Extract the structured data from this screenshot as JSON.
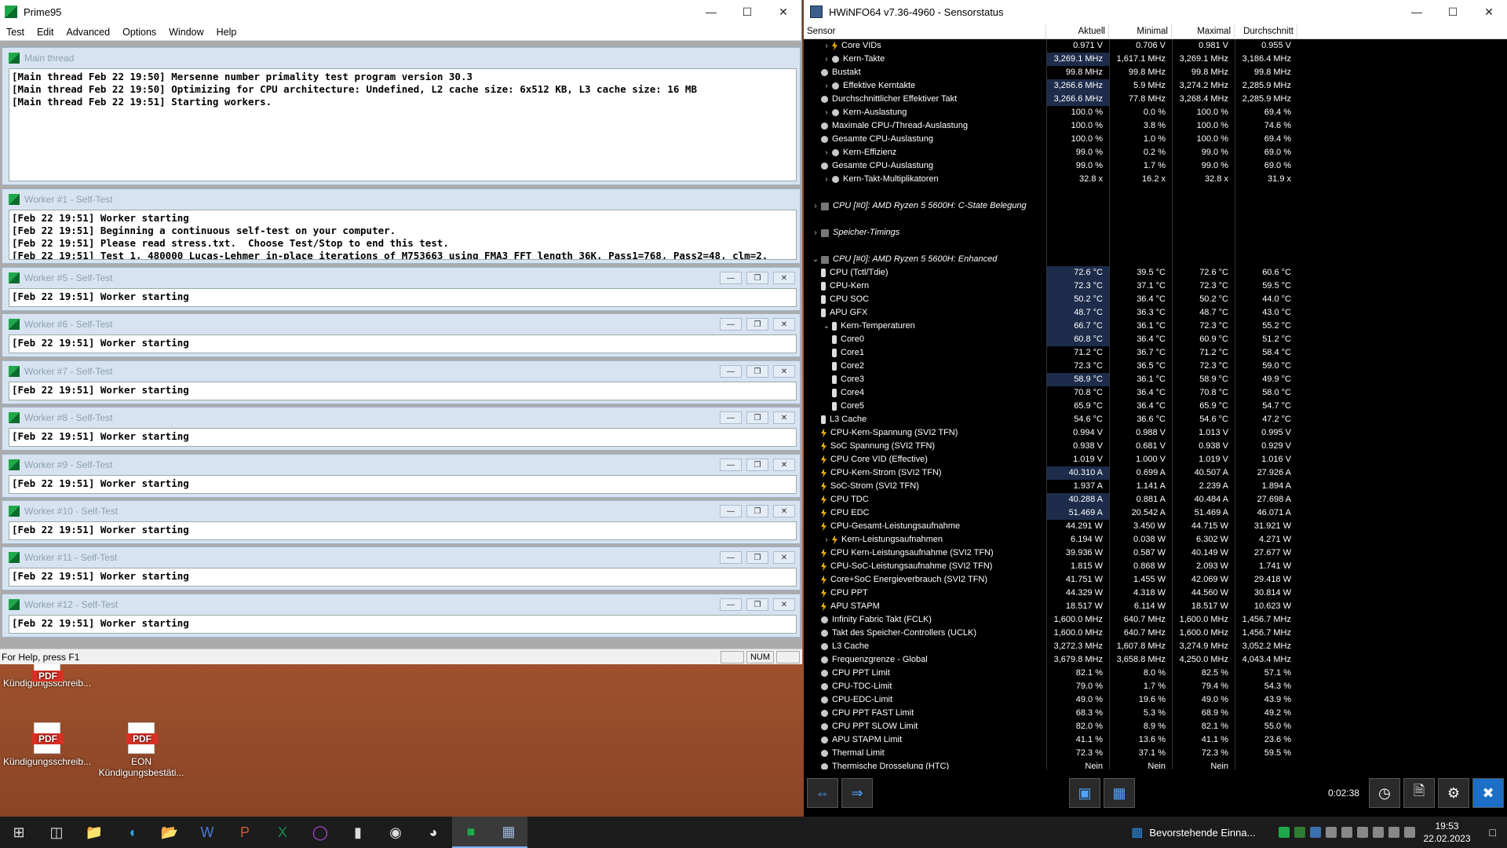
{
  "prime95": {
    "title": "Prime95",
    "menu": [
      "Test",
      "Edit",
      "Advanced",
      "Options",
      "Window",
      "Help"
    ],
    "main": {
      "title": "Main thread",
      "lines": [
        "[Main thread Feb 22 19:50] Mersenne number primality test program version 30.3",
        "[Main thread Feb 22 19:50] Optimizing for CPU architecture: Undefined, L2 cache size: 6x512 KB, L3 cache size: 16 MB",
        "[Main thread Feb 22 19:51] Starting workers."
      ]
    },
    "worker1": {
      "title": "Worker #1 - Self-Test",
      "lines": [
        "[Feb 22 19:51] Worker starting",
        "[Feb 22 19:51] Beginning a continuous self-test on your computer.",
        "[Feb 22 19:51] Please read stress.txt.  Choose Test/Stop to end this test.",
        "[Feb 22 19:51] Test 1, 480000 Lucas-Lehmer in-place iterations of M753663 using FMA3 FFT length 36K, Pass1=768, Pass2=48, clm=2."
      ]
    },
    "workers": [
      {
        "title": "Worker #5 - Self-Test",
        "line": "[Feb 22 19:51] Worker starting"
      },
      {
        "title": "Worker #6 - Self-Test",
        "line": "[Feb 22 19:51] Worker starting"
      },
      {
        "title": "Worker #7 - Self-Test",
        "line": "[Feb 22 19:51] Worker starting"
      },
      {
        "title": "Worker #8 - Self-Test",
        "line": "[Feb 22 19:51] Worker starting"
      },
      {
        "title": "Worker #9 - Self-Test",
        "line": "[Feb 22 19:51] Worker starting"
      },
      {
        "title": "Worker #10 - Self-Test",
        "line": "[Feb 22 19:51] Worker starting"
      },
      {
        "title": "Worker #11 - Self-Test",
        "line": "[Feb 22 19:51] Worker starting"
      },
      {
        "title": "Worker #12 - Self-Test",
        "line": "[Feb 22 19:51] Worker starting"
      }
    ],
    "status": {
      "help": "For Help, press F1",
      "num": "NUM"
    }
  },
  "desktop": {
    "icons": [
      {
        "label": "Kündigungsschreib...",
        "icon": "pdf-icon"
      },
      {
        "label": "Kündigungsschreib...",
        "icon": "pdf-icon"
      },
      {
        "label": "EON Kündigungsbestäti...",
        "icon": "pdf-icon"
      }
    ]
  },
  "hwinfo": {
    "title": "HWiNFO64 v7.36-4960 - Sensorstatus",
    "columns": [
      "Sensor",
      "Aktuell",
      "Minimal",
      "Maximal",
      "Durchschnitt"
    ],
    "rows": [
      {
        "n": "Core VIDs",
        "i": "y",
        "e": ">",
        "l": 1,
        "v": [
          "0.971 V",
          "0.706 V",
          "0.981 V",
          "0.955 V"
        ]
      },
      {
        "n": "Kern-Takte",
        "i": "g",
        "e": ">",
        "l": 1,
        "h": 1,
        "v": [
          "3,269.1 MHz",
          "1,617.1 MHz",
          "3,269.1 MHz",
          "3,186.4 MHz"
        ]
      },
      {
        "n": "Bustakt",
        "i": "g",
        "e": "",
        "l": 0,
        "v": [
          "99.8 MHz",
          "99.8 MHz",
          "99.8 MHz",
          "99.8 MHz"
        ]
      },
      {
        "n": "Effektive Kerntakte",
        "i": "g",
        "e": ">",
        "l": 1,
        "h": 1,
        "v": [
          "3,266.6 MHz",
          "5.9 MHz",
          "3,274.2 MHz",
          "2,285.9 MHz"
        ]
      },
      {
        "n": "Durchschnittlicher Effektiver Takt",
        "i": "g",
        "e": "",
        "l": 0,
        "h": 1,
        "v": [
          "3,266.6 MHz",
          "77.8 MHz",
          "3,268.4 MHz",
          "2,285.9 MHz"
        ]
      },
      {
        "n": "Kern-Auslastung",
        "i": "g",
        "e": ">",
        "l": 1,
        "v": [
          "100.0 %",
          "0.0 %",
          "100.0 %",
          "69.4 %"
        ]
      },
      {
        "n": "Maximale CPU-/Thread-Auslastung",
        "i": "g",
        "e": "",
        "l": 0,
        "v": [
          "100.0 %",
          "3.8 %",
          "100.0 %",
          "74.6 %"
        ]
      },
      {
        "n": "Gesamte CPU-Auslastung",
        "i": "g",
        "e": "",
        "l": 0,
        "v": [
          "100.0 %",
          "1.0 %",
          "100.0 %",
          "69.4 %"
        ]
      },
      {
        "n": "Kern-Effizienz",
        "i": "g",
        "e": ">",
        "l": 1,
        "v": [
          "99.0 %",
          "0.2 %",
          "99.0 %",
          "69.0 %"
        ]
      },
      {
        "n": "Gesamte CPU-Auslastung",
        "i": "g",
        "e": "",
        "l": 0,
        "v": [
          "99.0 %",
          "1.7 %",
          "99.0 %",
          "69.0 %"
        ]
      },
      {
        "n": "Kern-Takt-Multiplikatoren",
        "i": "g",
        "e": ">",
        "l": 1,
        "v": [
          "32.8 x",
          "16.2 x",
          "32.8 x",
          "31.9 x"
        ]
      },
      {
        "n": "",
        "i": "",
        "e": "",
        "l": 0,
        "v": [
          "",
          "",
          "",
          ""
        ]
      },
      {
        "n": "CPU [#0]: AMD Ryzen 5 5600H: C-State Belegung",
        "i": "grp",
        "e": ">",
        "l": 0,
        "g": 1,
        "v": [
          "",
          "",
          "",
          ""
        ]
      },
      {
        "n": "",
        "i": "",
        "e": "",
        "l": 0,
        "v": [
          "",
          "",
          "",
          ""
        ]
      },
      {
        "n": "Speicher-Timings",
        "i": "grp",
        "e": ">",
        "l": 0,
        "g": 1,
        "v": [
          "",
          "",
          "",
          ""
        ]
      },
      {
        "n": "",
        "i": "",
        "e": "",
        "l": 0,
        "v": [
          "",
          "",
          "",
          ""
        ]
      },
      {
        "n": "CPU [#0]: AMD Ryzen 5 5600H: Enhanced",
        "i": "grp",
        "e": "v",
        "l": 0,
        "g": 1,
        "v": [
          "",
          "",
          "",
          ""
        ]
      },
      {
        "n": "CPU (Tctl/Tdie)",
        "i": "t",
        "e": "",
        "l": 0,
        "h": 1,
        "v": [
          "72.6 °C",
          "39.5 °C",
          "72.6 °C",
          "60.6 °C"
        ]
      },
      {
        "n": "CPU-Kern",
        "i": "t",
        "e": "",
        "l": 0,
        "h": 1,
        "v": [
          "72.3 °C",
          "37.1 °C",
          "72.3 °C",
          "59.5 °C"
        ]
      },
      {
        "n": "CPU SOC",
        "i": "t",
        "e": "",
        "l": 0,
        "h": 1,
        "v": [
          "50.2 °C",
          "36.4 °C",
          "50.2 °C",
          "44.0 °C"
        ]
      },
      {
        "n": "APU GFX",
        "i": "t",
        "e": "",
        "l": 0,
        "h": 1,
        "v": [
          "48.7 °C",
          "36.3 °C",
          "48.7 °C",
          "43.0 °C"
        ]
      },
      {
        "n": "Kern-Temperaturen",
        "i": "t",
        "e": "v",
        "l": 1,
        "h": 1,
        "v": [
          "66.7 °C",
          "36.1 °C",
          "72.3 °C",
          "55.2 °C"
        ]
      },
      {
        "n": "Core0",
        "i": "t",
        "e": "",
        "l": 1,
        "h": 1,
        "v": [
          "60.8 °C",
          "36.4 °C",
          "60.9 °C",
          "51.2 °C"
        ]
      },
      {
        "n": "Core1",
        "i": "t",
        "e": "",
        "l": 1,
        "v": [
          "71.2 °C",
          "36.7 °C",
          "71.2 °C",
          "58.4 °C"
        ]
      },
      {
        "n": "Core2",
        "i": "t",
        "e": "",
        "l": 1,
        "v": [
          "72.3 °C",
          "36.5 °C",
          "72.3 °C",
          "59.0 °C"
        ]
      },
      {
        "n": "Core3",
        "i": "t",
        "e": "",
        "l": 1,
        "h": 1,
        "v": [
          "58.9 °C",
          "36.1 °C",
          "58.9 °C",
          "49.9 °C"
        ]
      },
      {
        "n": "Core4",
        "i": "t",
        "e": "",
        "l": 1,
        "v": [
          "70.8 °C",
          "36.4 °C",
          "70.8 °C",
          "58.0 °C"
        ]
      },
      {
        "n": "Core5",
        "i": "t",
        "e": "",
        "l": 1,
        "v": [
          "65.9 °C",
          "36.4 °C",
          "65.9 °C",
          "54.7 °C"
        ]
      },
      {
        "n": "L3 Cache",
        "i": "t",
        "e": "",
        "l": 0,
        "v": [
          "54.6 °C",
          "36.6 °C",
          "54.6 °C",
          "47.2 °C"
        ]
      },
      {
        "n": "CPU-Kern-Spannung (SVI2 TFN)",
        "i": "y",
        "e": "",
        "l": 0,
        "v": [
          "0.994 V",
          "0.988 V",
          "1.013 V",
          "0.995 V"
        ]
      },
      {
        "n": "SoC Spannung (SVI2 TFN)",
        "i": "y",
        "e": "",
        "l": 0,
        "v": [
          "0.938 V",
          "0.681 V",
          "0.938 V",
          "0.929 V"
        ]
      },
      {
        "n": "CPU Core VID (Effective)",
        "i": "y",
        "e": "",
        "l": 0,
        "v": [
          "1.019 V",
          "1.000 V",
          "1.019 V",
          "1.016 V"
        ]
      },
      {
        "n": "CPU-Kern-Strom (SVI2 TFN)",
        "i": "y",
        "e": "",
        "l": 0,
        "h": 1,
        "v": [
          "40.310 A",
          "0.699 A",
          "40.507 A",
          "27.926 A"
        ]
      },
      {
        "n": "SoC-Strom (SVI2 TFN)",
        "i": "y",
        "e": "",
        "l": 0,
        "v": [
          "1.937 A",
          "1.141 A",
          "2.239 A",
          "1.894 A"
        ]
      },
      {
        "n": "CPU TDC",
        "i": "y",
        "e": "",
        "l": 0,
        "h": 1,
        "v": [
          "40.288 A",
          "0.881 A",
          "40.484 A",
          "27.698 A"
        ]
      },
      {
        "n": "CPU EDC",
        "i": "y",
        "e": "",
        "l": 0,
        "h": 1,
        "v": [
          "51.469 A",
          "20.542 A",
          "51.469 A",
          "46.071 A"
        ]
      },
      {
        "n": "CPU-Gesamt-Leistungsaufnahme",
        "i": "y",
        "e": "",
        "l": 0,
        "v": [
          "44.291 W",
          "3.450 W",
          "44.715 W",
          "31.921 W"
        ]
      },
      {
        "n": "Kern-Leistungsaufnahmen",
        "i": "y",
        "e": ">",
        "l": 1,
        "v": [
          "6.194 W",
          "0.038 W",
          "6.302 W",
          "4.271 W"
        ]
      },
      {
        "n": "CPU Kern-Leistungsaufnahme (SVI2 TFN)",
        "i": "y",
        "e": "",
        "l": 0,
        "v": [
          "39.936 W",
          "0.587 W",
          "40.149 W",
          "27.677 W"
        ]
      },
      {
        "n": "CPU-SoC-Leistungsaufnahme (SVI2 TFN)",
        "i": "y",
        "e": "",
        "l": 0,
        "v": [
          "1.815 W",
          "0.868 W",
          "2.093 W",
          "1.741 W"
        ]
      },
      {
        "n": "Core+SoC Energieverbrauch (SVI2 TFN)",
        "i": "y",
        "e": "",
        "l": 0,
        "v": [
          "41.751 W",
          "1.455 W",
          "42.069 W",
          "29.418 W"
        ]
      },
      {
        "n": "CPU PPT",
        "i": "y",
        "e": "",
        "l": 0,
        "v": [
          "44.329 W",
          "4.318 W",
          "44.560 W",
          "30.814 W"
        ]
      },
      {
        "n": "APU STAPM",
        "i": "y",
        "e": "",
        "l": 0,
        "v": [
          "18.517 W",
          "6.114 W",
          "18.517 W",
          "10.623 W"
        ]
      },
      {
        "n": "Infinity Fabric Takt (FCLK)",
        "i": "g",
        "e": "",
        "l": 0,
        "v": [
          "1,600.0 MHz",
          "640.7 MHz",
          "1,600.0 MHz",
          "1,456.7 MHz"
        ]
      },
      {
        "n": "Takt des Speicher-Controllers (UCLK)",
        "i": "g",
        "e": "",
        "l": 0,
        "v": [
          "1,600.0 MHz",
          "640.7 MHz",
          "1,600.0 MHz",
          "1,456.7 MHz"
        ]
      },
      {
        "n": "L3 Cache",
        "i": "g",
        "e": "",
        "l": 0,
        "v": [
          "3,272.3 MHz",
          "1,607.8 MHz",
          "3,274.9 MHz",
          "3,052.2 MHz"
        ]
      },
      {
        "n": "Frequenzgrenze - Global",
        "i": "g",
        "e": "",
        "l": 0,
        "v": [
          "3,679.8 MHz",
          "3,658.8 MHz",
          "4,250.0 MHz",
          "4,043.4 MHz"
        ]
      },
      {
        "n": "CPU PPT Limit",
        "i": "g",
        "e": "",
        "l": 0,
        "v": [
          "82.1 %",
          "8.0 %",
          "82.5 %",
          "57.1 %"
        ]
      },
      {
        "n": "CPU-TDC-Limit",
        "i": "g",
        "e": "",
        "l": 0,
        "v": [
          "79.0 %",
          "1.7 %",
          "79.4 %",
          "54.3 %"
        ]
      },
      {
        "n": "CPU-EDC-Limit",
        "i": "g",
        "e": "",
        "l": 0,
        "v": [
          "49.0 %",
          "19.6 %",
          "49.0 %",
          "43.9 %"
        ]
      },
      {
        "n": "CPU PPT FAST Limit",
        "i": "g",
        "e": "",
        "l": 0,
        "v": [
          "68.3 %",
          "5.3 %",
          "68.9 %",
          "49.2 %"
        ]
      },
      {
        "n": "CPU PPT SLOW Limit",
        "i": "g",
        "e": "",
        "l": 0,
        "v": [
          "82.0 %",
          "8.9 %",
          "82.1 %",
          "55.0 %"
        ]
      },
      {
        "n": "APU STAPM Limit",
        "i": "g",
        "e": "",
        "l": 0,
        "v": [
          "41.1 %",
          "13.6 %",
          "41.1 %",
          "23.6 %"
        ]
      },
      {
        "n": "Thermal Limit",
        "i": "g",
        "e": "",
        "l": 0,
        "v": [
          "72.3 %",
          "37.1 %",
          "72.3 %",
          "59.5 %"
        ]
      },
      {
        "n": "Thermische Drosselung (HTC)",
        "i": "g",
        "e": "",
        "l": 0,
        "v": [
          "Nein",
          "Nein",
          "Nein",
          ""
        ]
      }
    ],
    "timer": "0:02:38"
  },
  "taskbar": {
    "notification": "Bevorstehende Einna...",
    "time": "19:53",
    "date": "22.02.2023"
  }
}
